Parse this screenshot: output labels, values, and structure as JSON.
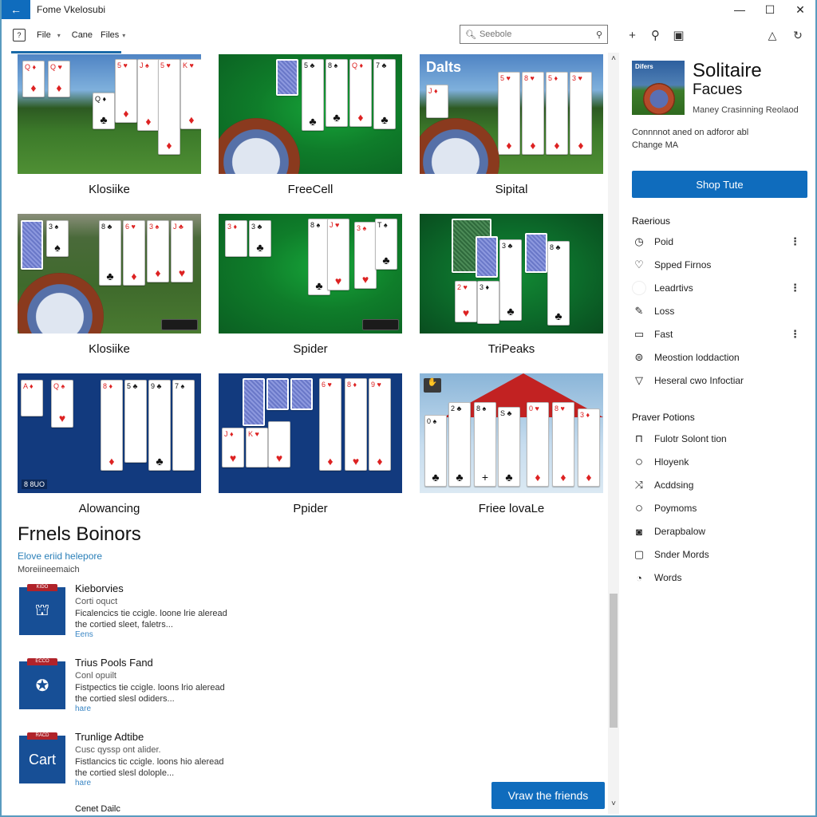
{
  "window": {
    "title": "Fome Vkelosubi",
    "controls": {
      "minimize": "—",
      "maximize": "☐",
      "close": "✕"
    }
  },
  "toolbar": {
    "menus": [
      {
        "label": "File",
        "has_dropdown": true
      },
      {
        "label": "Cane",
        "has_dropdown": false
      },
      {
        "label": "Files",
        "has_dropdown": true
      }
    ],
    "search": {
      "placeholder": "Seebole",
      "value": ""
    },
    "actions": [
      {
        "icon": "plus-icon",
        "glyph": "+"
      },
      {
        "icon": "pin-icon",
        "glyph": "⚲"
      },
      {
        "icon": "save-icon",
        "glyph": "▣"
      }
    ],
    "right_actions": [
      {
        "icon": "bell-icon",
        "glyph": "△"
      },
      {
        "icon": "refresh-icon",
        "glyph": "↻"
      }
    ]
  },
  "games": [
    {
      "title": "Klosiike",
      "theme": "park"
    },
    {
      "title": "FreeCell",
      "theme": "green"
    },
    {
      "title": "Sipital",
      "theme": "park",
      "overlay": "Dalts"
    },
    {
      "title": "Klosiike",
      "theme": "park"
    },
    {
      "title": "Spider",
      "theme": "green"
    },
    {
      "title": "TriPeaks",
      "theme": "darkgreen"
    },
    {
      "title": "Alowancing",
      "theme": "navy",
      "overlay": "8 8UO"
    },
    {
      "title": "Ppider",
      "theme": "navy"
    },
    {
      "title": "Friee lovaLe",
      "theme": "tent"
    }
  ],
  "friends": {
    "title": "Frnels Boinors",
    "link": "Elove eriid helepore",
    "subtitle": "Moreiineemaich",
    "items": [
      {
        "name": "Kieborvies",
        "sub": "Corti oquct",
        "desc": "Ficalencics tie ccigle. loone lrie aleread the cortied sleet, faletrs...",
        "more": "Eens",
        "ribbon": "KIDO",
        "icon": "castle-icon",
        "glyph": "⛫"
      },
      {
        "name": "Trius Pools Fand",
        "sub": "Conl opuilt",
        "desc": "Fistpectics tie ccigle. loons lrio aleread the cortied slesl odiders...",
        "more": "hare",
        "ribbon": "ECCO",
        "icon": "star-badge-icon",
        "glyph": "✪"
      },
      {
        "name": "Trunlige Adtibe",
        "sub": "Cusc qyssp ont alider.",
        "desc": "Fistlancics tic ccigle. loons hio aleread the cortied slesl dolople...",
        "more": "hare",
        "ribbon": "RACD",
        "icon": "cart-text-icon",
        "glyph": "Cart"
      },
      {
        "name": "Cenet Dailc",
        "sub": "",
        "desc": "",
        "more": "",
        "ribbon": "",
        "icon": "",
        "glyph": ""
      }
    ],
    "view_button": "Vraw the friends"
  },
  "side": {
    "hero": {
      "image_tag": "Difers",
      "title": "Solitaire",
      "subtitle": "Facues",
      "caption": "Maney Crasinning Reolaod",
      "desc_line1": "Connnnot aned on adforor abl",
      "desc_line2": "Change MA",
      "button": "Shop Tute"
    },
    "section1": {
      "title": "Raerious",
      "items": [
        {
          "label": "Poid",
          "icon": "clock-icon",
          "glyph": "◷",
          "menu": true
        },
        {
          "label": "Spped Firnos",
          "icon": "heart-icon",
          "glyph": "♡",
          "menu": false
        },
        {
          "label": "Leadrtivs",
          "icon": "blank-circle-icon",
          "glyph": "",
          "menu": true
        },
        {
          "label": "Loss",
          "icon": "pencil-icon",
          "glyph": "⁄",
          "menu": false
        },
        {
          "label": "Fast",
          "icon": "tv-icon",
          "glyph": "▭",
          "menu": true
        },
        {
          "label": "Meostion loddaction",
          "icon": "microphone-icon",
          "glyph": "🎙",
          "menu": false
        },
        {
          "label": "Heseral cwo Infoctiar",
          "icon": "filter-icon",
          "glyph": "▽",
          "menu": false
        }
      ]
    },
    "section2": {
      "title": "Praver Potions",
      "items": [
        {
          "label": "Fulotr Solont tion",
          "icon": "lock-icon",
          "glyph": "🔒"
        },
        {
          "label": "Hloyenk",
          "icon": "circle-icon",
          "glyph": "○"
        },
        {
          "label": "Acddsing",
          "icon": "shuffle-icon",
          "glyph": "⤨"
        },
        {
          "label": "Poymoms",
          "icon": "circle-icon",
          "glyph": "○"
        },
        {
          "label": "Derapbalow",
          "icon": "target-box-icon",
          "glyph": "◙"
        },
        {
          "label": "Snder Mords",
          "icon": "window-icon",
          "glyph": "▢"
        },
        {
          "label": "Words",
          "icon": "timer-icon",
          "glyph": "◔"
        }
      ]
    }
  },
  "colors": {
    "accent": "#0f6cbd",
    "link": "#2a7fb8",
    "friend_icon_bg": "#174f96",
    "ribbon": "#b0232a"
  }
}
